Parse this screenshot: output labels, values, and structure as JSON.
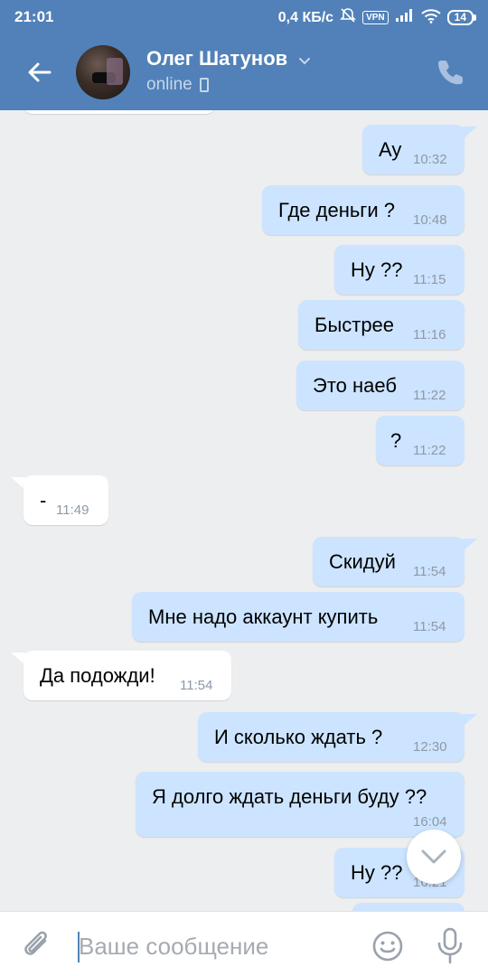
{
  "status_bar": {
    "time": "21:01",
    "speed": "0,4 КБ/с",
    "vpn": "VPN",
    "battery": "14"
  },
  "header": {
    "contact_name": "Олег Шатунов",
    "presence": "online",
    "icons": [
      "back-arrow-icon",
      "chevron-down-icon",
      "mobile-phone-icon",
      "phone-call-icon"
    ]
  },
  "messages": [
    {
      "dir": "out",
      "text": "Ау",
      "time": "10:32"
    },
    {
      "dir": "out",
      "text": "Где деньги ?",
      "time": "10:48"
    },
    {
      "dir": "out",
      "text": "Ну ??",
      "time": "11:15"
    },
    {
      "dir": "out",
      "text": "Быстрее",
      "time": "11:16"
    },
    {
      "dir": "out",
      "text": "Это наеб",
      "time": "11:22"
    },
    {
      "dir": "out",
      "text": "?",
      "time": "11:22"
    },
    {
      "dir": "in",
      "text": "-",
      "time": "11:49"
    },
    {
      "dir": "out",
      "text": "Скидуй",
      "time": "11:54"
    },
    {
      "dir": "out",
      "text": "Мне надо аккаунт купить",
      "time": "11:54"
    },
    {
      "dir": "in",
      "text": "Да подожди!",
      "time": "11:54"
    },
    {
      "dir": "out",
      "text": "И сколько ждать ?",
      "time": "12:30"
    },
    {
      "dir": "out",
      "text": "Я долго ждать деньги буду ??",
      "time": "16:04"
    },
    {
      "dir": "out",
      "text": "Ну ??",
      "time": "16:21"
    }
  ],
  "composer": {
    "placeholder": "Ваше сообщение",
    "icons": [
      "paperclip-icon",
      "emoji-icon",
      "microphone-icon",
      "scroll-down-icon"
    ]
  },
  "colors": {
    "header": "#5181b8",
    "background": "#edeef0",
    "outgoing_bubble": "#cce4ff",
    "incoming_bubble": "#ffffff",
    "time_text": "#8e99a5"
  }
}
